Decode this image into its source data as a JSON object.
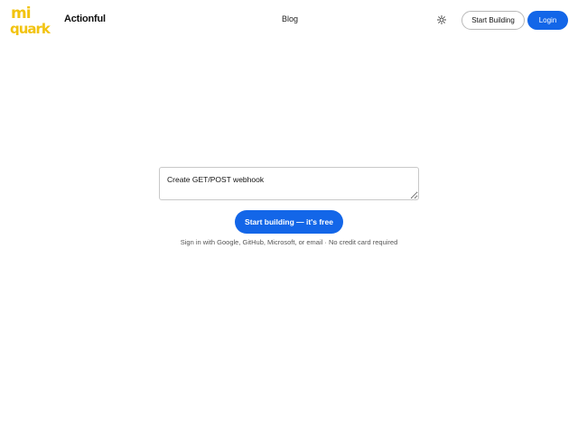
{
  "header": {
    "logo_text": "mi quark",
    "brand": "Actionful",
    "nav_blog": "Blog",
    "theme_icon": "sun-icon",
    "start_building_label": "Start Building",
    "login_label": "Login"
  },
  "hero": {
    "title": "",
    "subtitle": ""
  },
  "prompt": {
    "value": "Create GET/POST webhook"
  },
  "cta": {
    "label": "Start building — it's free",
    "note": "Sign in with Google, GitHub, Microsoft, or email · No credit card required"
  },
  "colors": {
    "accent": "#1366e8",
    "logo_yellow": "#f2c30f"
  }
}
